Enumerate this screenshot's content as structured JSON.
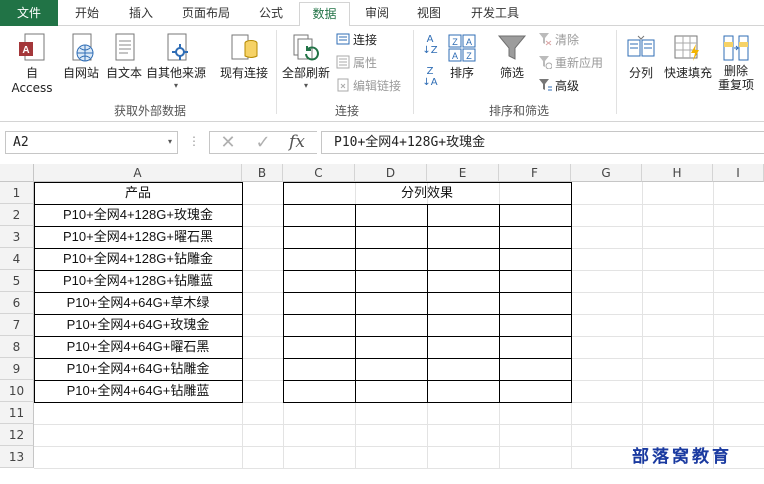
{
  "tabs": [
    "文件",
    "开始",
    "插入",
    "页面布局",
    "公式",
    "数据",
    "审阅",
    "视图",
    "开发工具"
  ],
  "active_tab": "数据",
  "ribbon": {
    "get_external": {
      "group_label": "获取外部数据",
      "buttons": [
        "自 Access",
        "自网站",
        "自文本",
        "自其他来源",
        "现有连接"
      ]
    },
    "connections": {
      "group_label": "连接",
      "refresh_all": "全部刷新",
      "items": [
        "连接",
        "属性",
        "编辑链接"
      ]
    },
    "sort_filter": {
      "group_label": "排序和筛选",
      "sort": "排序",
      "filter": "筛选",
      "items": [
        "清除",
        "重新应用",
        "高级"
      ],
      "sort_asc_glyph": "A↓Z",
      "sort_desc_glyph": "Z↓A"
    },
    "data_tools": {
      "buttons": [
        "分列",
        "快速填充",
        "删除",
        "重复项"
      ]
    }
  },
  "formula_bar": {
    "name_box": "A2",
    "formula": "P10+全网4+128G+玫瑰金",
    "fx": "fx",
    "cancel_glyph": "✕",
    "enter_glyph": "✓"
  },
  "columns": [
    "A",
    "B",
    "C",
    "D",
    "E",
    "F",
    "G",
    "H",
    "I"
  ],
  "rows": [
    "1",
    "2",
    "3",
    "4",
    "5",
    "6",
    "7",
    "8",
    "9",
    "10",
    "11",
    "12",
    "13"
  ],
  "table_a": {
    "header": "产品",
    "values": [
      "P10+全网4+128G+玫瑰金",
      "P10+全网4+128G+曜石黑",
      "P10+全网4+128G+钻雕金",
      "P10+全网4+128G+钻雕蓝",
      "P10+全网4+64G+草木绿",
      "P10+全网4+64G+玫瑰金",
      "P10+全网4+64G+曜石黑",
      "P10+全网4+64G+钻雕金",
      "P10+全网4+64G+钻雕蓝"
    ]
  },
  "table_split": {
    "header": "分列效果"
  },
  "watermark": "部落窝教育",
  "colors": {
    "accent": "#217346",
    "watermark": "#1a3aa0"
  }
}
